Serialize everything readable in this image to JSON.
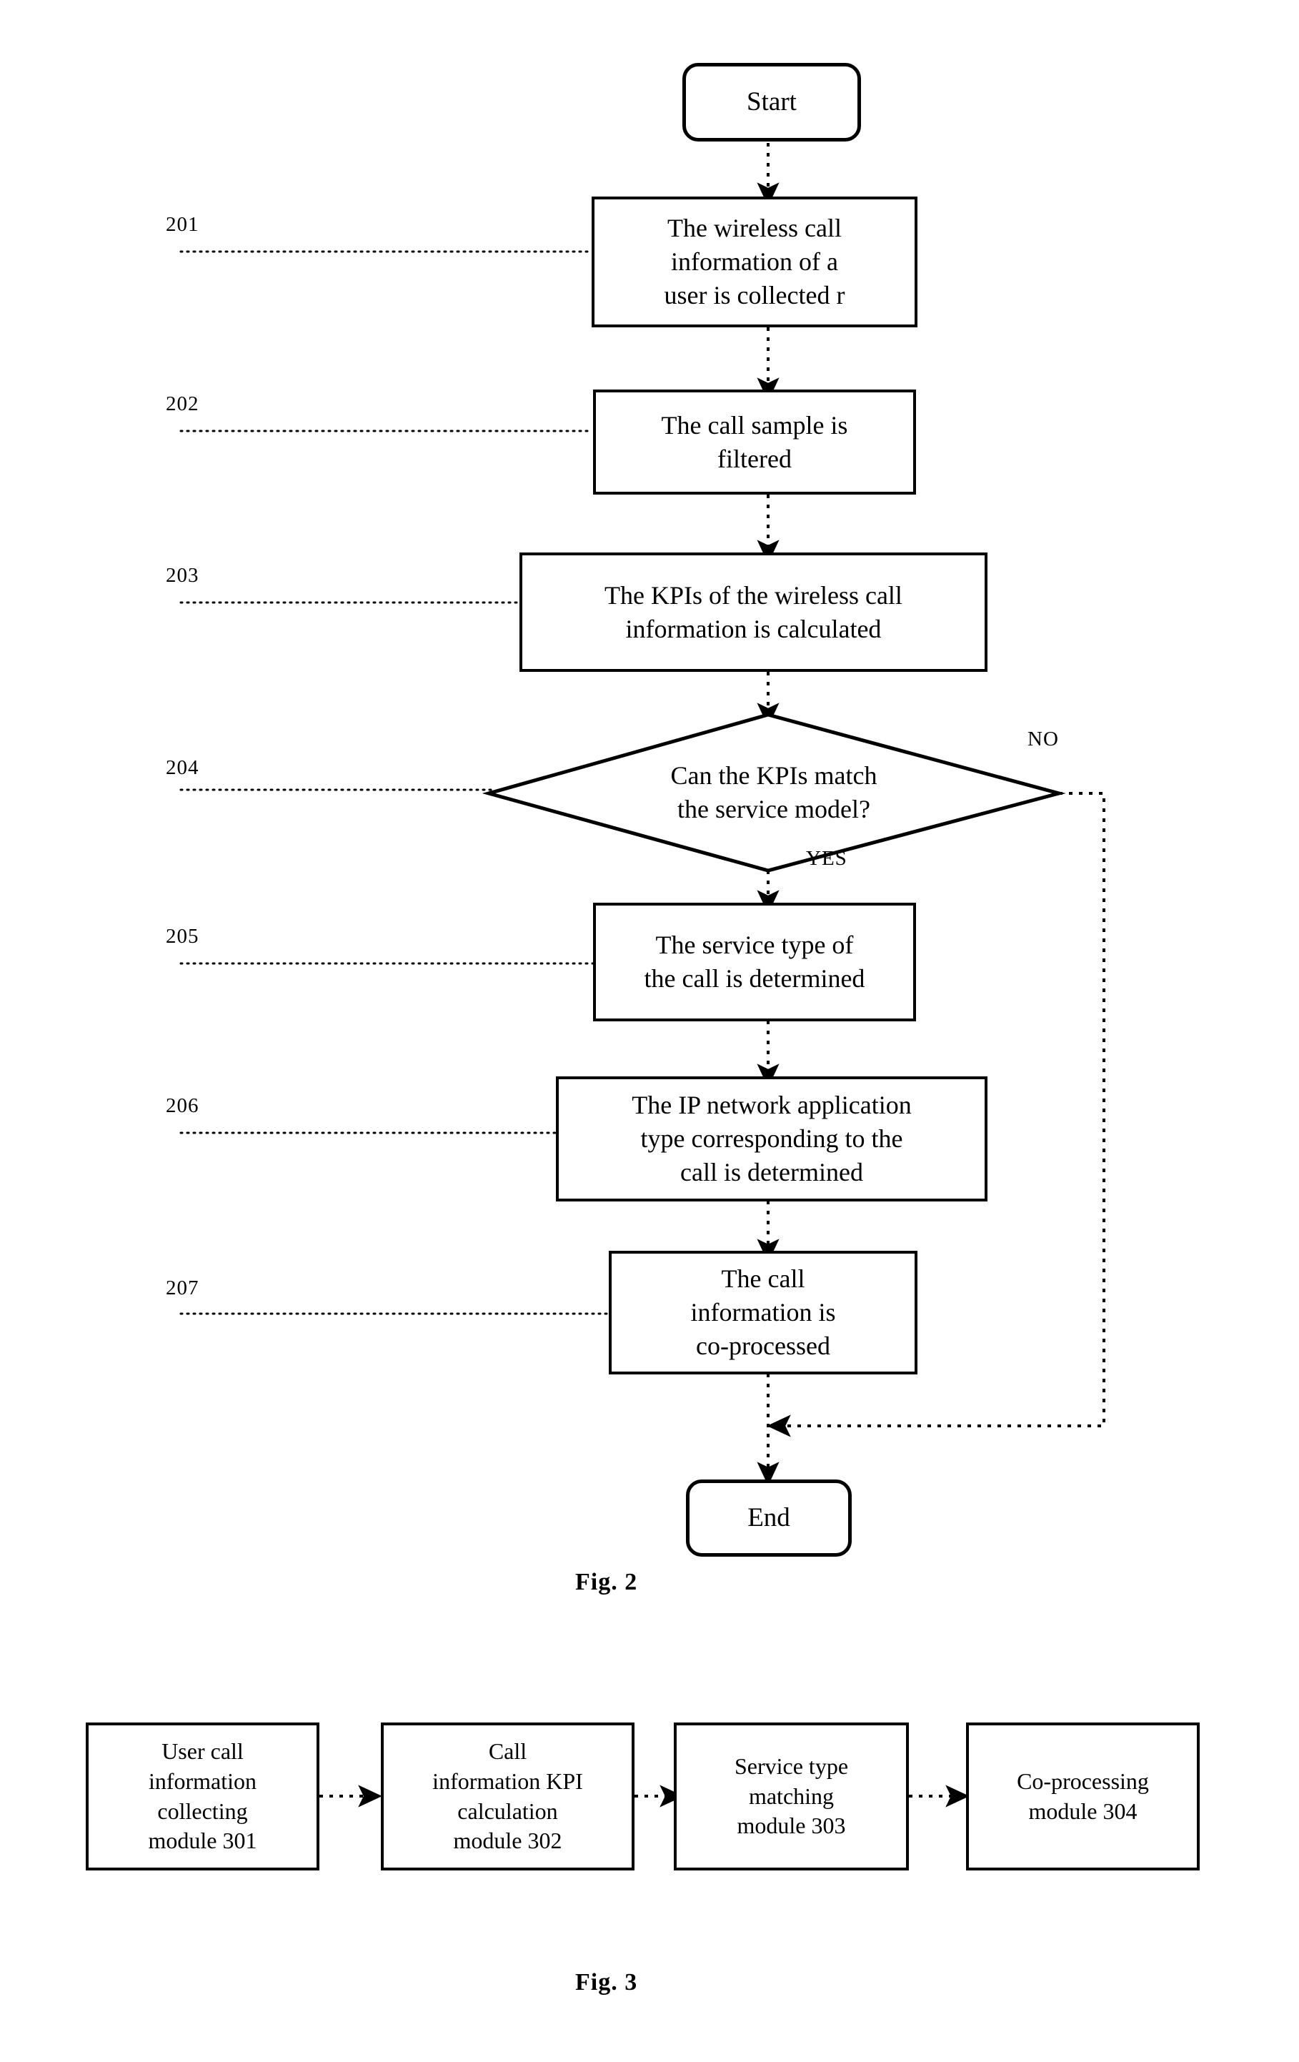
{
  "document": {
    "type": "patent-flowchart-sheet"
  },
  "figure2": {
    "caption": "Fig. 2",
    "start_label": "Start",
    "end_label": "End",
    "branch_yes": "YES",
    "branch_no": "NO",
    "steps": [
      {
        "number": "201",
        "text": "The wireless call\ninformation of a\nuser is collected r"
      },
      {
        "number": "202",
        "text": "The call sample is\nfiltered"
      },
      {
        "number": "203",
        "text": "The KPIs of the wireless call\ninformation is calculated"
      },
      {
        "number": "204",
        "text": "Can the KPIs match\nthe service model?"
      },
      {
        "number": "205",
        "text": "The service type of\nthe call is determined"
      },
      {
        "number": "206",
        "text": "The IP network application\ntype corresponding to the\ncall is determined"
      },
      {
        "number": "207",
        "text": "The call\ninformation is\nco-processed"
      }
    ]
  },
  "figure3": {
    "caption": "Fig. 3",
    "modules": [
      {
        "text": "User call\ninformation\ncollecting\nmodule 301"
      },
      {
        "text": "Call\ninformation KPI\ncalculation\nmodule 302"
      },
      {
        "text": "Service type\nmatching\nmodule 303"
      },
      {
        "text": "Co-processing\nmodule 304"
      }
    ]
  },
  "colors": {
    "ink": "#000000",
    "paper": "#ffffff"
  }
}
